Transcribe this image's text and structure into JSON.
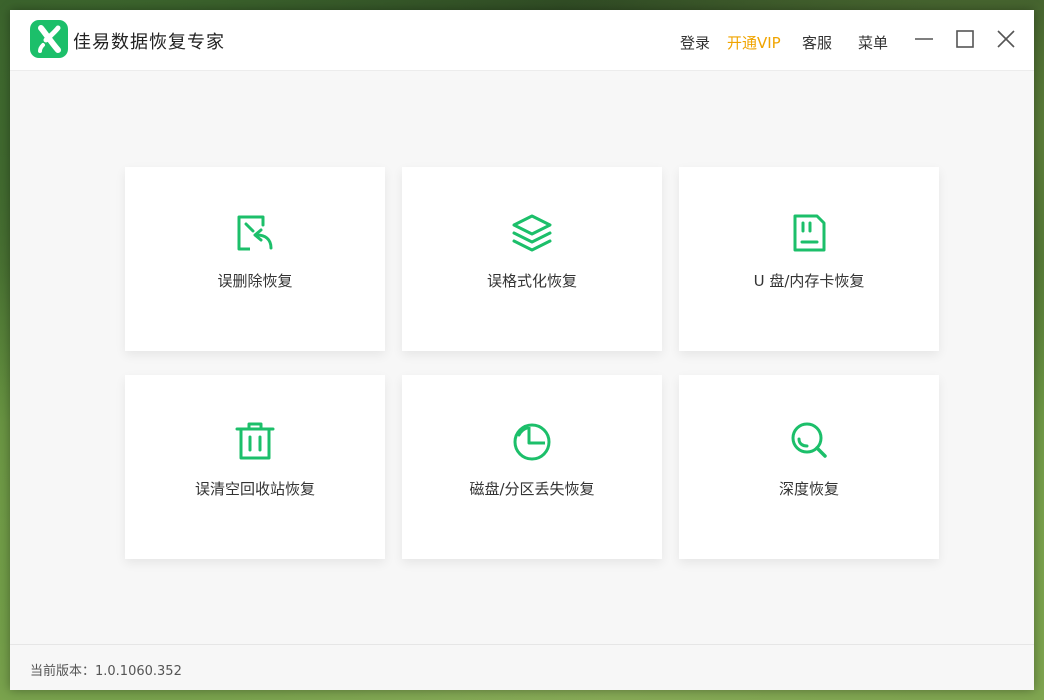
{
  "app": {
    "title": "佳易数据恢复专家",
    "accent_color": "#1cbf6a",
    "vip_color": "#f0a400"
  },
  "header": {
    "login": "登录",
    "vip": "开通VIP",
    "support": "客服",
    "menu": "菜单",
    "window_controls": [
      "minimize-icon",
      "maximize-icon",
      "close-icon"
    ]
  },
  "cards": [
    {
      "label": "误删除恢复",
      "icon": "restore-file-icon"
    },
    {
      "label": "误格式化恢复",
      "icon": "layers-icon"
    },
    {
      "label": "U 盘/内存卡恢复",
      "icon": "sd-card-icon"
    },
    {
      "label": "误清空回收站恢复",
      "icon": "trash-icon"
    },
    {
      "label": "磁盘/分区丢失恢复",
      "icon": "pie-chart-icon"
    },
    {
      "label": "深度恢复",
      "icon": "search-icon"
    }
  ],
  "footer": {
    "version_text": "当前版本：1.0.1060.352"
  }
}
